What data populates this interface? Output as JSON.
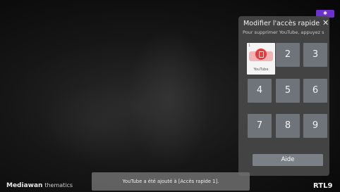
{
  "badge": "✱",
  "panel": {
    "title": "Modifier l'accès rapide",
    "subtitle": "Pour supprimer YouTube, appuyez s",
    "close_icon": "✕"
  },
  "slots": {
    "slot1_number": "1",
    "slot1_app": "YouTube",
    "keys": [
      "2",
      "3",
      "4",
      "5",
      "6",
      "7",
      "8",
      "9"
    ]
  },
  "help_button": "Aide",
  "toast": "YouTube a été ajouté à [Accès rapide 1].",
  "brand": {
    "left_bold": "Mediawan",
    "left_light": "thematics",
    "right": "RTL9"
  },
  "colors": {
    "delete_accent": "#ea3a3a",
    "badge": "#6d2fd1"
  },
  "icons": {
    "close": "close-icon",
    "delete": "delete-icon"
  }
}
